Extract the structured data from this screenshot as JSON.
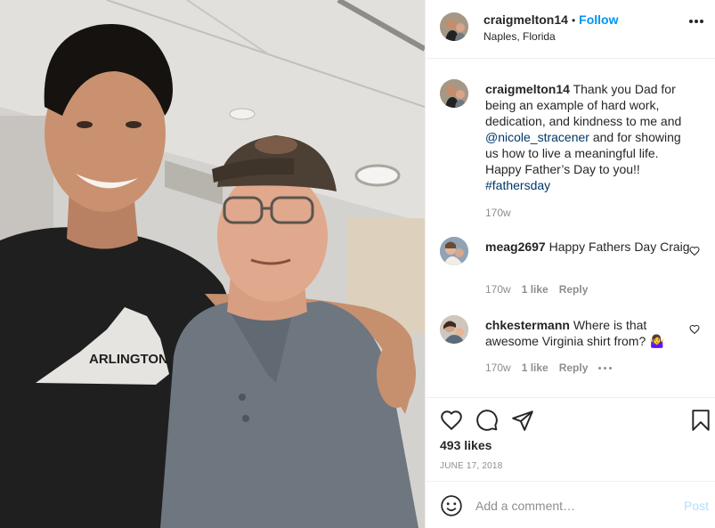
{
  "post": {
    "username": "craigmelton14",
    "follow_label": "Follow",
    "location": "Naples, Florida",
    "shirt_text": "ARLINGTON VA"
  },
  "caption": {
    "username": "craigmelton14",
    "text_1": " Thank you Dad for being an example of hard work, dedication, and kindness to me and ",
    "mention": "@nicole_stracener",
    "text_2": " and for showing us how to live a meaningful life. Happy Father’s Day to you!! ",
    "hashtag": "#fathersday",
    "age": "170w"
  },
  "comments": [
    {
      "username": "meag2697",
      "text": " Happy Fathers Day Craig",
      "age": "170w",
      "likes": "1 like",
      "reply": "Reply"
    },
    {
      "username": "chkestermann",
      "text": " Where is that awesome Virginia shirt from? 🤷‍♀️",
      "age": "170w",
      "likes": "1 like",
      "reply": "Reply"
    }
  ],
  "footer": {
    "likes": "493 likes",
    "date": "JUNE 17, 2018",
    "comment_placeholder": "Add a comment…",
    "post_label": "Post"
  },
  "icons": {
    "like": "heart-icon",
    "comment": "speech-bubble-icon",
    "share": "paper-plane-icon",
    "save": "bookmark-icon",
    "emoji": "smiley-icon",
    "more": "ellipsis-icon"
  },
  "colors": {
    "link": "#0095f6",
    "mention": "#00376b",
    "muted": "#8e8e8e",
    "post_disabled": "#b2dffc"
  }
}
